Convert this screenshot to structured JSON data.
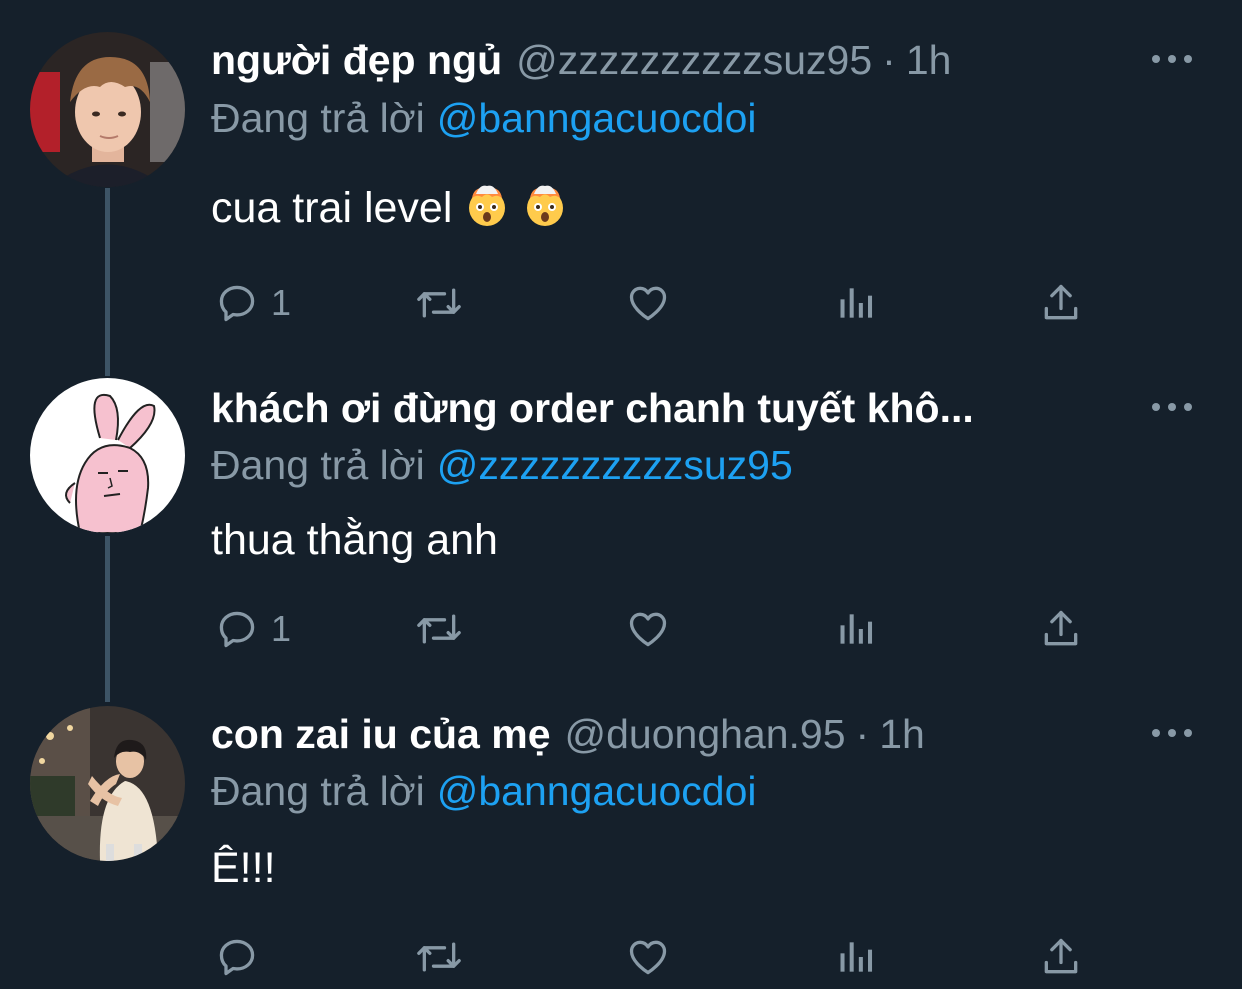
{
  "tweets": [
    {
      "name": "người đẹp ngủ",
      "handle": "@zzzzzzzzzzsuz95",
      "separator": "·",
      "time": "1h",
      "reply_label": "Đang trả lời",
      "reply_to": "@banngacuocdoi",
      "text": "cua trai level",
      "emojis": [
        "exploding-head-emoji",
        "exploding-head-emoji"
      ],
      "reply_count": "1"
    },
    {
      "name": "khách ơi đừng order chanh tuyết khô...",
      "reply_label": "Đang trả lời",
      "reply_to": "@zzzzzzzzzzsuz95",
      "text": "thua thằng anh",
      "reply_count": "1"
    },
    {
      "name": "con zai iu của mẹ",
      "handle": "@duonghan.95",
      "separator": "·",
      "time": "1h",
      "reply_label": "Đang trả lời",
      "reply_to": "@banngacuocdoi",
      "text": "Ê!!!",
      "reply_count": ""
    }
  ],
  "icons": {
    "reply": "reply-icon",
    "retweet": "retweet-icon",
    "like": "heart-icon",
    "analytics": "analytics-icon",
    "share": "share-icon",
    "more": "more-icon"
  },
  "colors": {
    "background": "#15202b",
    "primary_text": "#ffffff",
    "secondary_text": "#8899a6",
    "link": "#1da1f2",
    "thread_line": "#3d5466"
  }
}
